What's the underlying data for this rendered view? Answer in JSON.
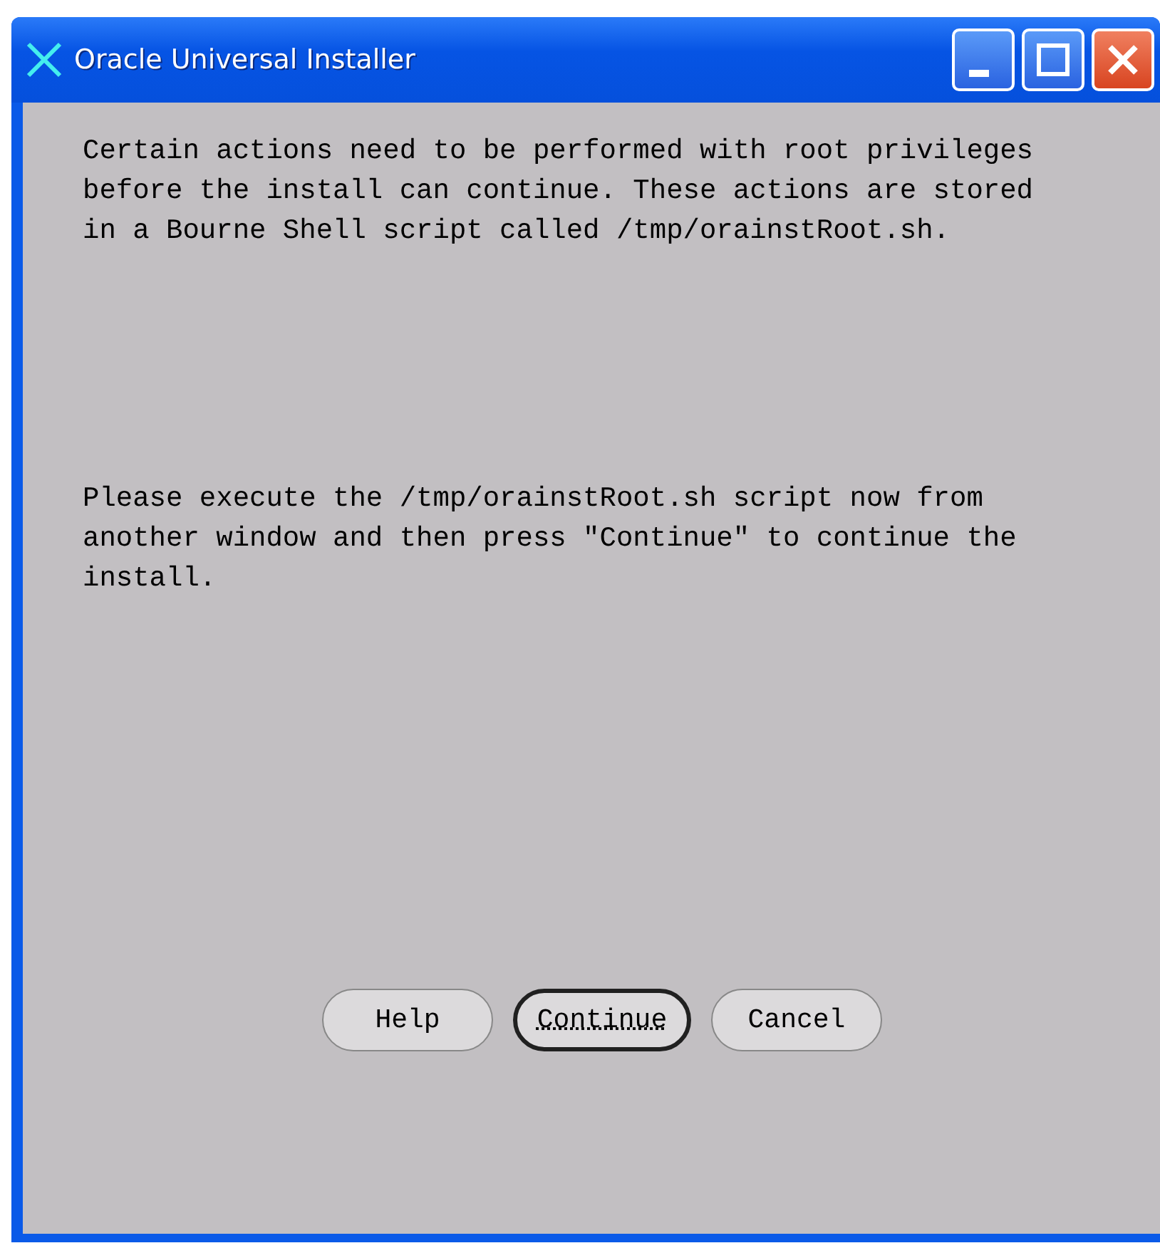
{
  "window": {
    "title": "Oracle Universal Installer"
  },
  "paragraphs": [
    "Certain actions need to be performed with root privileges\nbefore the install can continue. These actions are stored\nin a Bourne Shell script called /tmp/orainstRoot.sh.",
    "Please execute the /tmp/orainstRoot.sh script now from\nanother window and then press \"Continue\" to continue the\ninstall."
  ],
  "buttons": [
    {
      "label": "Help",
      "default": false
    },
    {
      "label": "Continue",
      "default": true
    },
    {
      "label": "Cancel",
      "default": false
    }
  ]
}
